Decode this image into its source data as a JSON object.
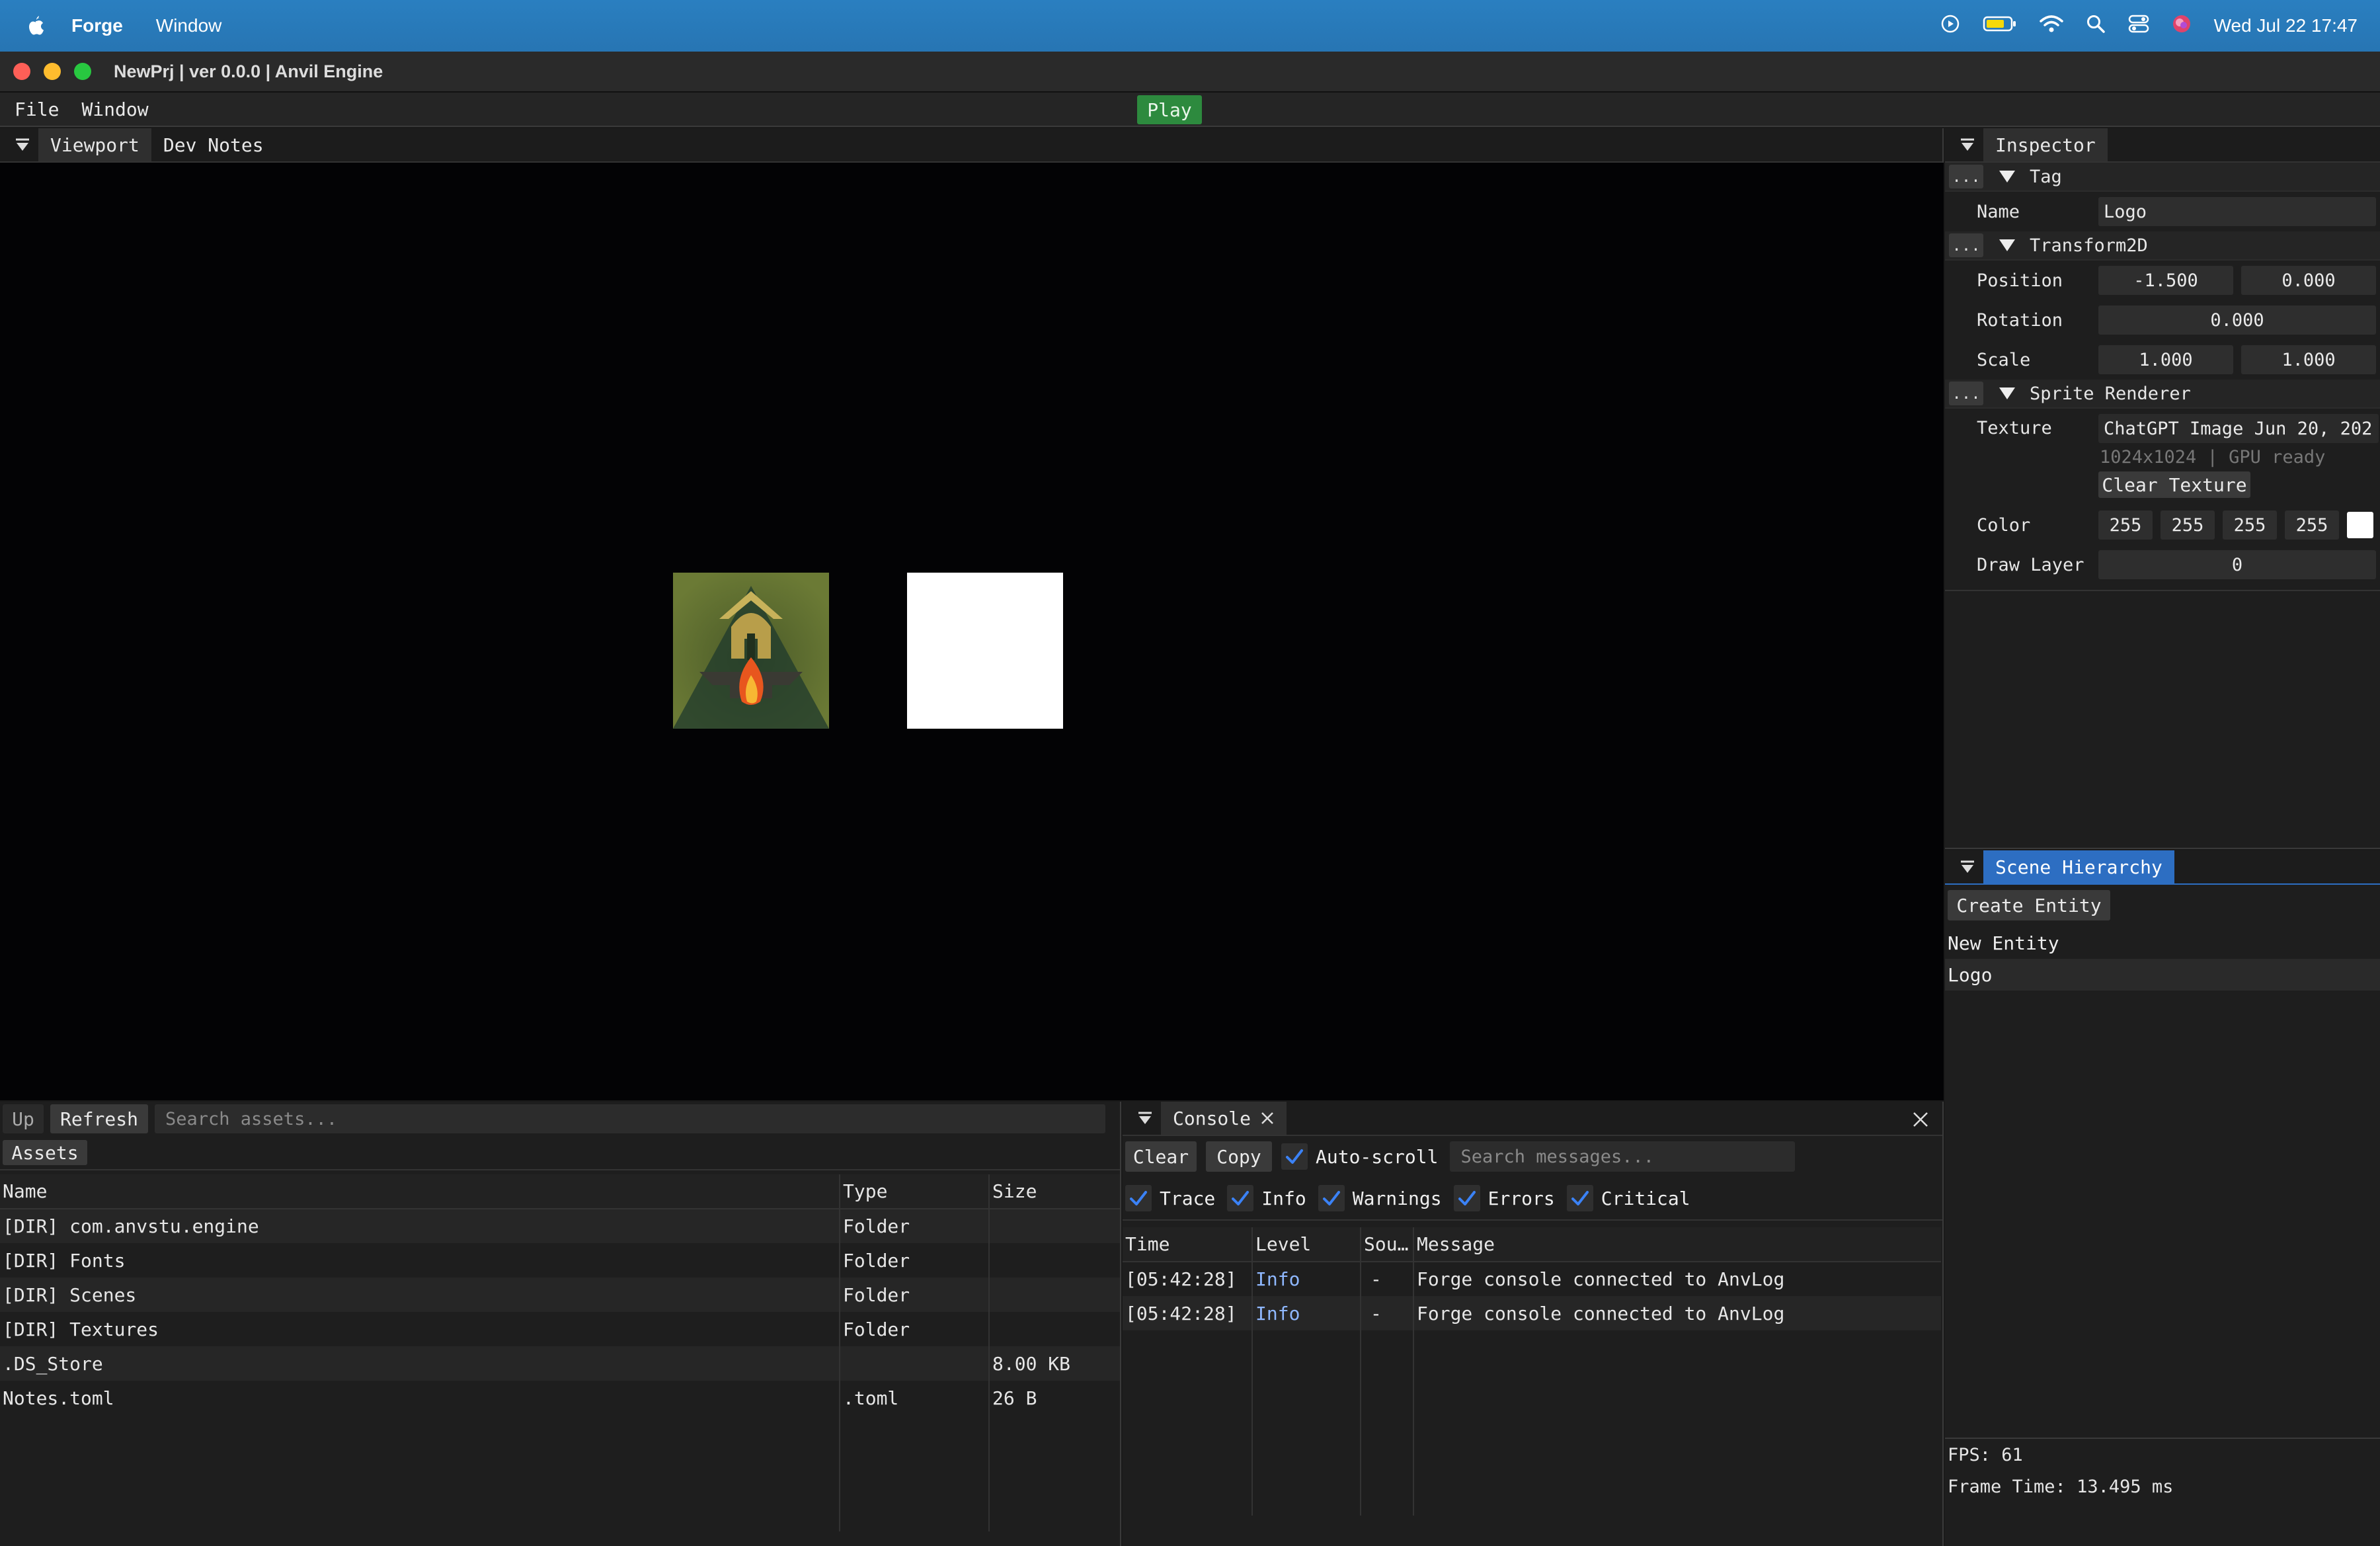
{
  "menubar": {
    "app_name": "Forge",
    "items": [
      "Window"
    ],
    "clock": "Wed Jul 22  17:47"
  },
  "window": {
    "title": "NewPrj | ver 0.0.0 | Anvil Engine",
    "menu": [
      "File",
      "Window"
    ],
    "play_label": "Play"
  },
  "viewport_panel": {
    "tabs": [
      "Viewport",
      "Dev Notes"
    ]
  },
  "inspector": {
    "tab": "Inspector",
    "tag": {
      "header": "Tag",
      "name_label": "Name",
      "name_value": "Logo"
    },
    "transform": {
      "header": "Transform2D",
      "position_label": "Position",
      "position_x": "-1.500",
      "position_y": "0.000",
      "rotation_label": "Rotation",
      "rotation": "0.000",
      "scale_label": "Scale",
      "scale_x": "1.000",
      "scale_y": "1.000"
    },
    "sprite": {
      "header": "Sprite Renderer",
      "texture_label": "Texture",
      "texture_value": "ChatGPT Image Jun 20, 202",
      "texture_info": "1024x1024 | GPU ready",
      "clear_texture": "Clear Texture",
      "color_label": "Color",
      "color_r": "255",
      "color_g": "255",
      "color_b": "255",
      "color_a": "255",
      "draw_layer_label": "Draw Layer",
      "draw_layer": "0"
    },
    "dots": "..."
  },
  "hierarchy": {
    "tab": "Scene Hierarchy",
    "create_entity": "Create Entity",
    "entities": [
      "New Entity",
      "Logo"
    ]
  },
  "stats": {
    "fps": "FPS: 61",
    "frame_time": "Frame Time: 13.495 ms"
  },
  "assets": {
    "up": "Up",
    "refresh": "Refresh",
    "search_placeholder": "Search assets...",
    "breadcrumb": "Assets",
    "columns": [
      "Name",
      "Type",
      "Size"
    ],
    "rows": [
      {
        "name": "[DIR] com.anvstu.engine",
        "type": "Folder",
        "size": ""
      },
      {
        "name": "[DIR] Fonts",
        "type": "Folder",
        "size": ""
      },
      {
        "name": "[DIR] Scenes",
        "type": "Folder",
        "size": ""
      },
      {
        "name": "[DIR] Textures",
        "type": "Folder",
        "size": ""
      },
      {
        "name": ".DS_Store",
        "type": "",
        "size": "8.00 KB"
      },
      {
        "name": "Notes.toml",
        "type": ".toml",
        "size": "26 B"
      }
    ]
  },
  "console": {
    "tab": "Console",
    "clear": "Clear",
    "copy": "Copy",
    "autoscroll": "Auto-scroll",
    "search_placeholder": "Search messages...",
    "filters": [
      "Trace",
      "Info",
      "Warnings",
      "Errors",
      "Critical"
    ],
    "columns": [
      "Time",
      "Level",
      "Sou…",
      "Message"
    ],
    "rows": [
      {
        "time": "[05:42:28]",
        "level": "Info",
        "source": "-",
        "message": "Forge console connected to AnvLog"
      },
      {
        "time": "[05:42:28]",
        "level": "Info",
        "source": "-",
        "message": "Forge console connected to AnvLog"
      }
    ]
  },
  "colors": {
    "accent_blue": "#2d6ec2",
    "play_green": "#2d8a3e",
    "check_blue": "#3b82f6"
  }
}
